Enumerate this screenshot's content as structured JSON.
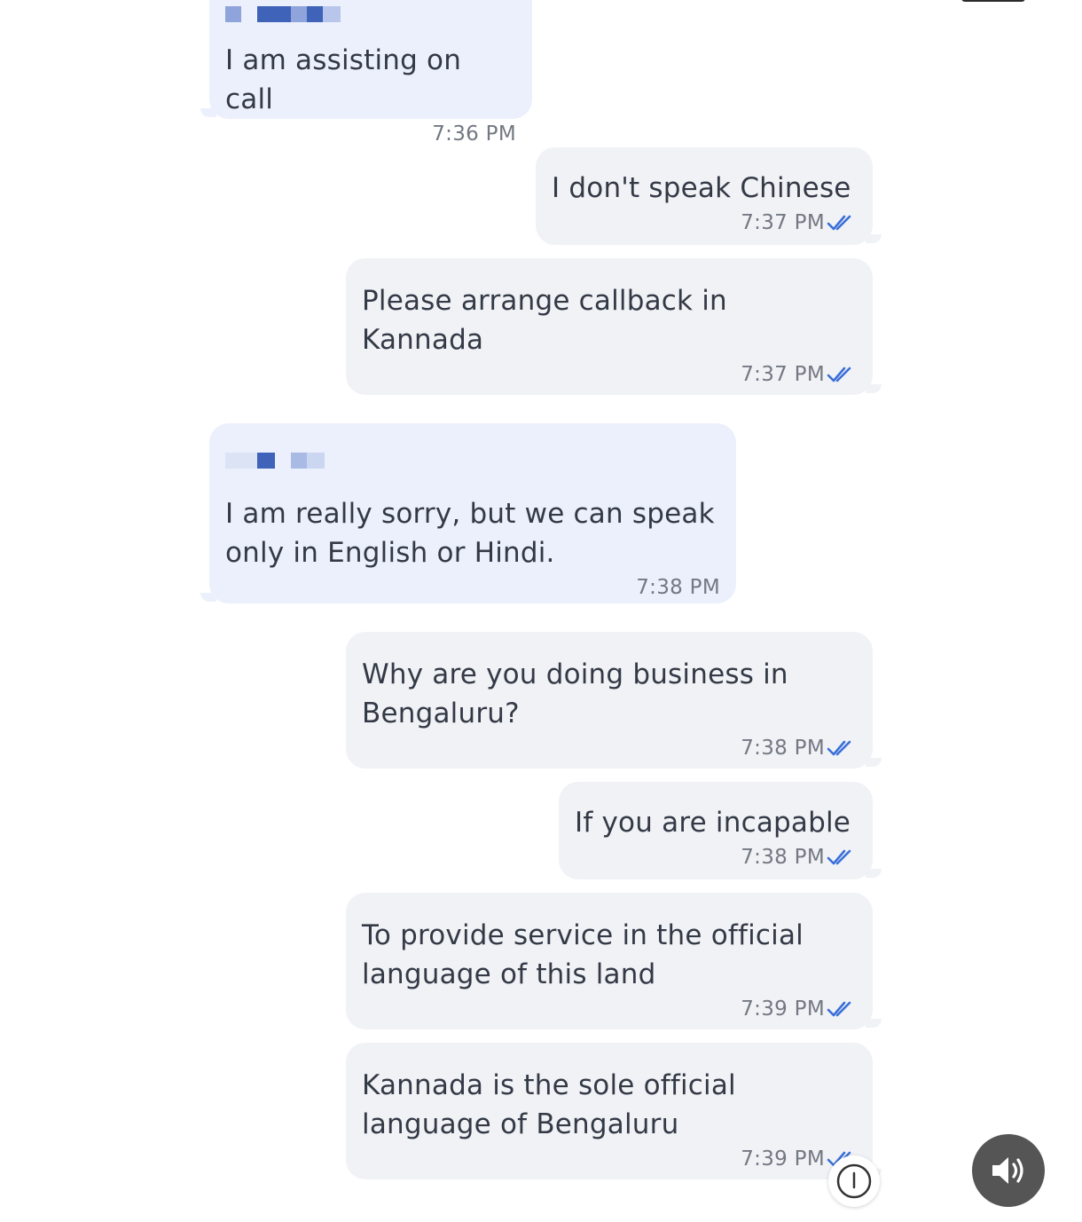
{
  "messages": [
    {
      "direction": "incoming",
      "text": "I am assisting on call",
      "time": "7:36 PM",
      "sender_redacted": true
    },
    {
      "direction": "outgoing",
      "text": "I don't speak Chinese",
      "time": "7:37 PM",
      "status": "read"
    },
    {
      "direction": "outgoing",
      "text": "Please arrange callback in\nKannada",
      "time": "7:37 PM",
      "status": "read"
    },
    {
      "direction": "incoming",
      "text": "I am really sorry, but we can speak\nonly in English or Hindi.",
      "time": "7:38 PM",
      "sender_redacted": true
    },
    {
      "direction": "outgoing",
      "text": "Why are you doing business in\nBengaluru?",
      "time": "7:38 PM",
      "status": "read"
    },
    {
      "direction": "outgoing",
      "text": "If you are incapable",
      "time": "7:38 PM",
      "status": "read"
    },
    {
      "direction": "outgoing",
      "text": "To provide service in the official\nlanguage of this land",
      "time": "7:39 PM",
      "status": "read"
    },
    {
      "direction": "outgoing",
      "text": "Kannada is the sole official\nlanguage of Bengaluru",
      "time": "7:39 PM",
      "status": "read"
    }
  ],
  "icons": {
    "read_receipt": "double-check-icon",
    "sound": "speaker-icon",
    "scroll": "chevron-down-icon"
  },
  "colors": {
    "incoming_bubble": "#ebf0fc",
    "outgoing_bubble": "#f1f2f6",
    "tick": "#3a6fd8",
    "redaction": "#3e63b8"
  }
}
